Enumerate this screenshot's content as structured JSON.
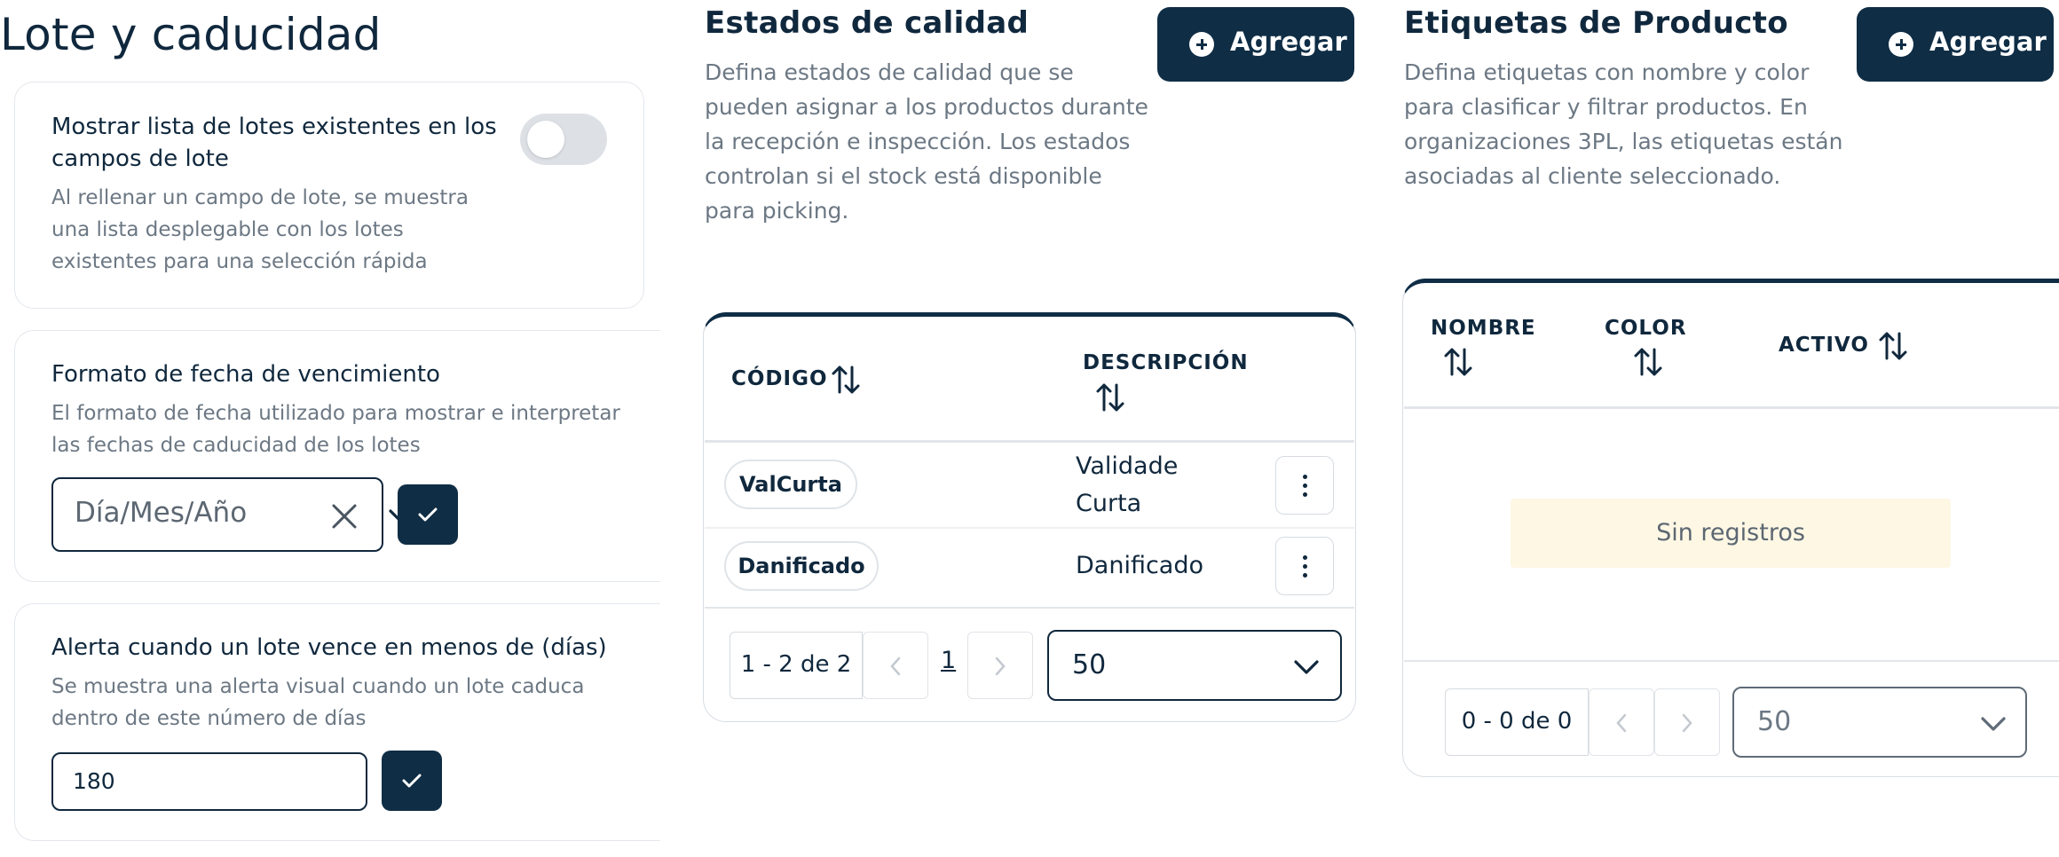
{
  "lote": {
    "title": "Lote y caducidad",
    "show_list": {
      "title_line1": "Mostrar lista de lotes existentes en los",
      "title_line2": "campos de lote",
      "desc_line1": "Al rellenar un campo de lote, se muestra",
      "desc_line2": "una lista desplegable con los lotes",
      "desc_line3": "existentes para una selección rápida",
      "enabled": false
    },
    "date_format": {
      "title": "Formato de fecha de vencimiento",
      "desc_line1": "El formato de fecha utilizado para mostrar e interpretar",
      "desc_line2": "las fechas de caducidad de los lotes",
      "value": "Día/Mes/Año"
    },
    "expiry_alert": {
      "title": "Alerta cuando un lote vence en menos de (días)",
      "desc_line1": "Se muestra una alerta visual cuando un lote caduca",
      "desc_line2": "dentro de este número de días",
      "value": "180"
    }
  },
  "quality": {
    "title": "Estados de calidad",
    "add_label": "Agregar",
    "desc_lines": [
      "Defina estados de calidad que se",
      "pueden asignar a los productos durante",
      "la recepción e inspección. Los estados",
      "controlan si el stock está disponible",
      "para picking."
    ],
    "columns": [
      "CÓDIGO",
      "DESCRIPCIÓN"
    ],
    "rows": [
      {
        "code": "ValCurta",
        "desc_line1": "Validade",
        "desc_line2": "Curta"
      },
      {
        "code": "Danificado",
        "desc_line1": "Danificado"
      }
    ],
    "pagination": {
      "range": "1 - 2 de 2",
      "page": "1",
      "per_page": "50"
    }
  },
  "tags": {
    "title": "Etiquetas de Producto",
    "add_label": "Agregar",
    "desc_lines": [
      "Defina etiquetas con nombre y color",
      "para clasificar y filtrar productos. En",
      "organizaciones 3PL, las etiquetas están",
      "asociadas al cliente seleccionado."
    ],
    "columns": [
      "NOMBRE",
      "COLOR",
      "ACTIVO"
    ],
    "empty": "Sin registros",
    "pagination": {
      "range": "0 - 0 de 0",
      "per_page": "50"
    }
  }
}
